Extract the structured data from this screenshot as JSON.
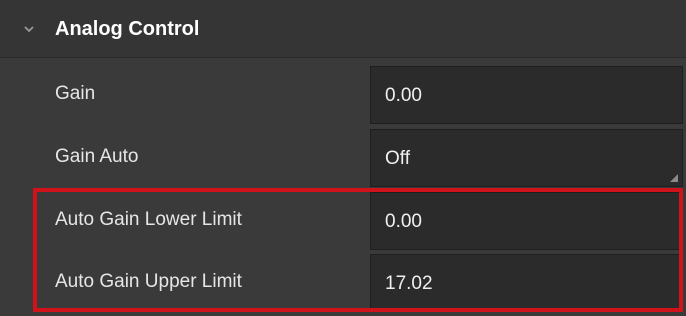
{
  "section": {
    "title": "Analog Control",
    "icon": "chevron-down-icon"
  },
  "rows": [
    {
      "label": "Gain",
      "value": "0.00"
    },
    {
      "label": "Gain Auto",
      "value": "Off"
    },
    {
      "label": "Auto Gain Lower Limit",
      "value": "0.00"
    },
    {
      "label": "Auto Gain Upper Limit",
      "value": "17.02"
    }
  ],
  "colors": {
    "highlight": "#d0121a",
    "background": "#3a3a3a",
    "field": "#2b2b2b"
  }
}
